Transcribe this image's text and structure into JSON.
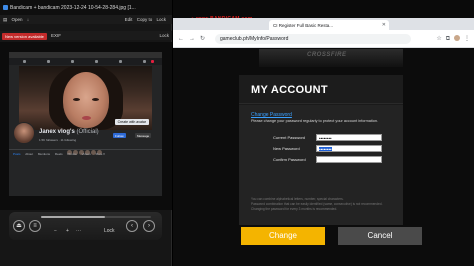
{
  "viewer": {
    "title": "Bandicam + bandicam 2023-12-24 10-54-28-284.jpg [1...",
    "toolbar_left": [
      "▤",
      "Open",
      "↓"
    ],
    "toolbar_right": [
      "Edit",
      "Copy to",
      "Lock"
    ],
    "toolbar2_left": "EXIF",
    "toolbar2_right": "Lock",
    "badge": "New version available",
    "zoom_label": "Lock",
    "progress_fraction": 0.58
  },
  "facebook": {
    "name": "Janex vlog's",
    "official": "(Official)",
    "meta": "1.5K followers · 11 following",
    "follow_label": "Follow",
    "message_label": "Message",
    "cover_button": "Create with avatar",
    "tabs": [
      "Posts",
      "About",
      "Mentions",
      "Reels",
      "Photos",
      "Videos",
      "More ▾"
    ]
  },
  "browser": {
    "recorder": "www.BANDICAM.com",
    "tab_title": "CI Register Full Basic Resta...",
    "url": "gameclub.ph/MyInfo/Password",
    "window_controls": "–  □  ✕"
  },
  "page": {
    "banner_logo": "CROSSFIRE",
    "heading": "MY ACCOUNT",
    "section_title": "Change Password",
    "section_desc": "Please change your password regularly to protect your account information.",
    "current_label": "Current Password",
    "current_value": "••••••••",
    "new_label": "New Password",
    "new_value": "••••••••",
    "confirm_label": "Confirm Password",
    "confirm_value": "",
    "notes": [
      "You can combine alphabetical letters, number, special characters.",
      "Password combination that can be easily identified (same, consecutive) is not recommended.",
      "Changing the password for every 3 months is recommended."
    ],
    "change_button": "Change",
    "cancel_button": "Cancel"
  },
  "colors": {
    "accent": "#f4b400",
    "link": "#3aa0ff",
    "cancel": "#4a4a4a",
    "selection": "#1e5fd6"
  }
}
